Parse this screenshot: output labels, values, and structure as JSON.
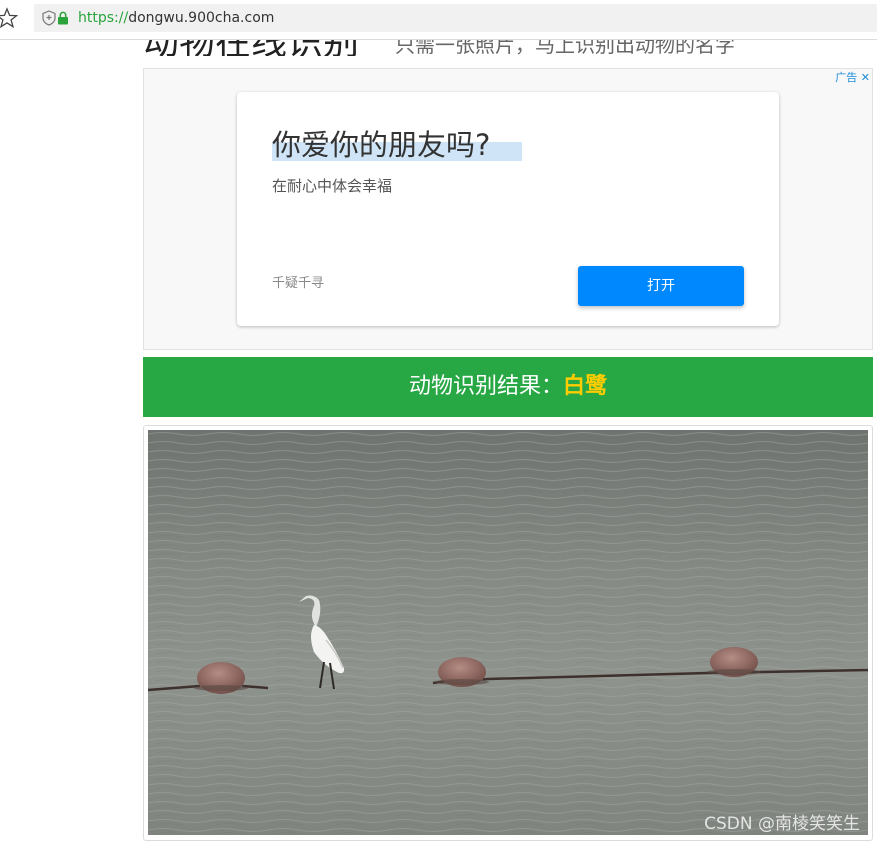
{
  "browser": {
    "url_scheme": "https://",
    "url_host": "dongwu.900cha.com"
  },
  "site": {
    "title": "动物在线识别",
    "subtitle": "只需一张照片，马上识别出动物的名字"
  },
  "ad": {
    "tag": "广告",
    "close_symbol": "✕",
    "headline": "你爱你的朋友吗?",
    "description": "在耐心中体会幸福",
    "brand": "千疑千寻",
    "button_label": "打开"
  },
  "result": {
    "label": "动物识别结果：",
    "animal": "白鹭"
  },
  "photo": {
    "watermark": "CSDN @南棱笑笑生"
  },
  "colors": {
    "result_bg": "#28a745",
    "result_animal": "#ffcc00",
    "ad_button": "#0088ff",
    "url_scheme": "#2aa33b"
  },
  "icons": [
    "star-icon",
    "shield-icon",
    "lock-icon",
    "close-icon"
  ]
}
